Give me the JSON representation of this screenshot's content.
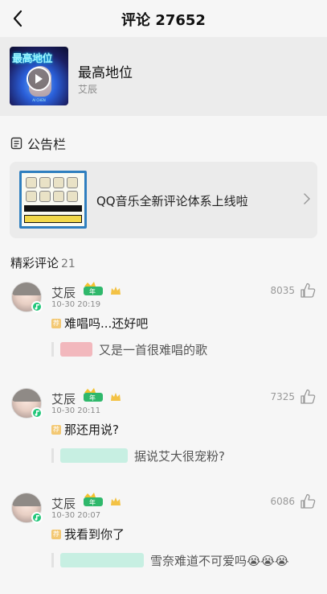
{
  "header": {
    "title": "评论 27652"
  },
  "song": {
    "cover_text": "最高地位",
    "cover_small_text": "AI CHEN",
    "name": "最高地位",
    "artist": "艾辰"
  },
  "notice": {
    "title": "公告栏",
    "card_text": "QQ音乐全新评论体系上线啦"
  },
  "comments_section": {
    "title": "精彩评论",
    "count": "21"
  },
  "comments": [
    {
      "user": "艾辰",
      "time": "10-30 20:19",
      "likes": "8035",
      "text": "难唱吗...还好吧",
      "reply": "又是一首很难唱的歌",
      "reply_blur_color": "#f2b8bd"
    },
    {
      "user": "艾辰",
      "time": "10-30 20:11",
      "likes": "7325",
      "text": "那还用说?",
      "reply": "据说艾大很宠粉?",
      "reply_blur_color": "#c7efe2"
    },
    {
      "user": "艾辰",
      "time": "10-30 20:07",
      "likes": "6086",
      "text": "我看到你了",
      "reply": "雪奈难道不可爱吗😭😭😭",
      "reply_blur_color": "#c7efe2"
    }
  ],
  "colors": {
    "accent_green": "#22c77a",
    "tag_gold": "#f3c873"
  },
  "icons": [
    "back-icon",
    "play-icon",
    "notice-icon",
    "chevron-right-icon",
    "thumb-up-icon",
    "vip-badge-icon",
    "level-badge-icon",
    "music-badge-icon"
  ]
}
